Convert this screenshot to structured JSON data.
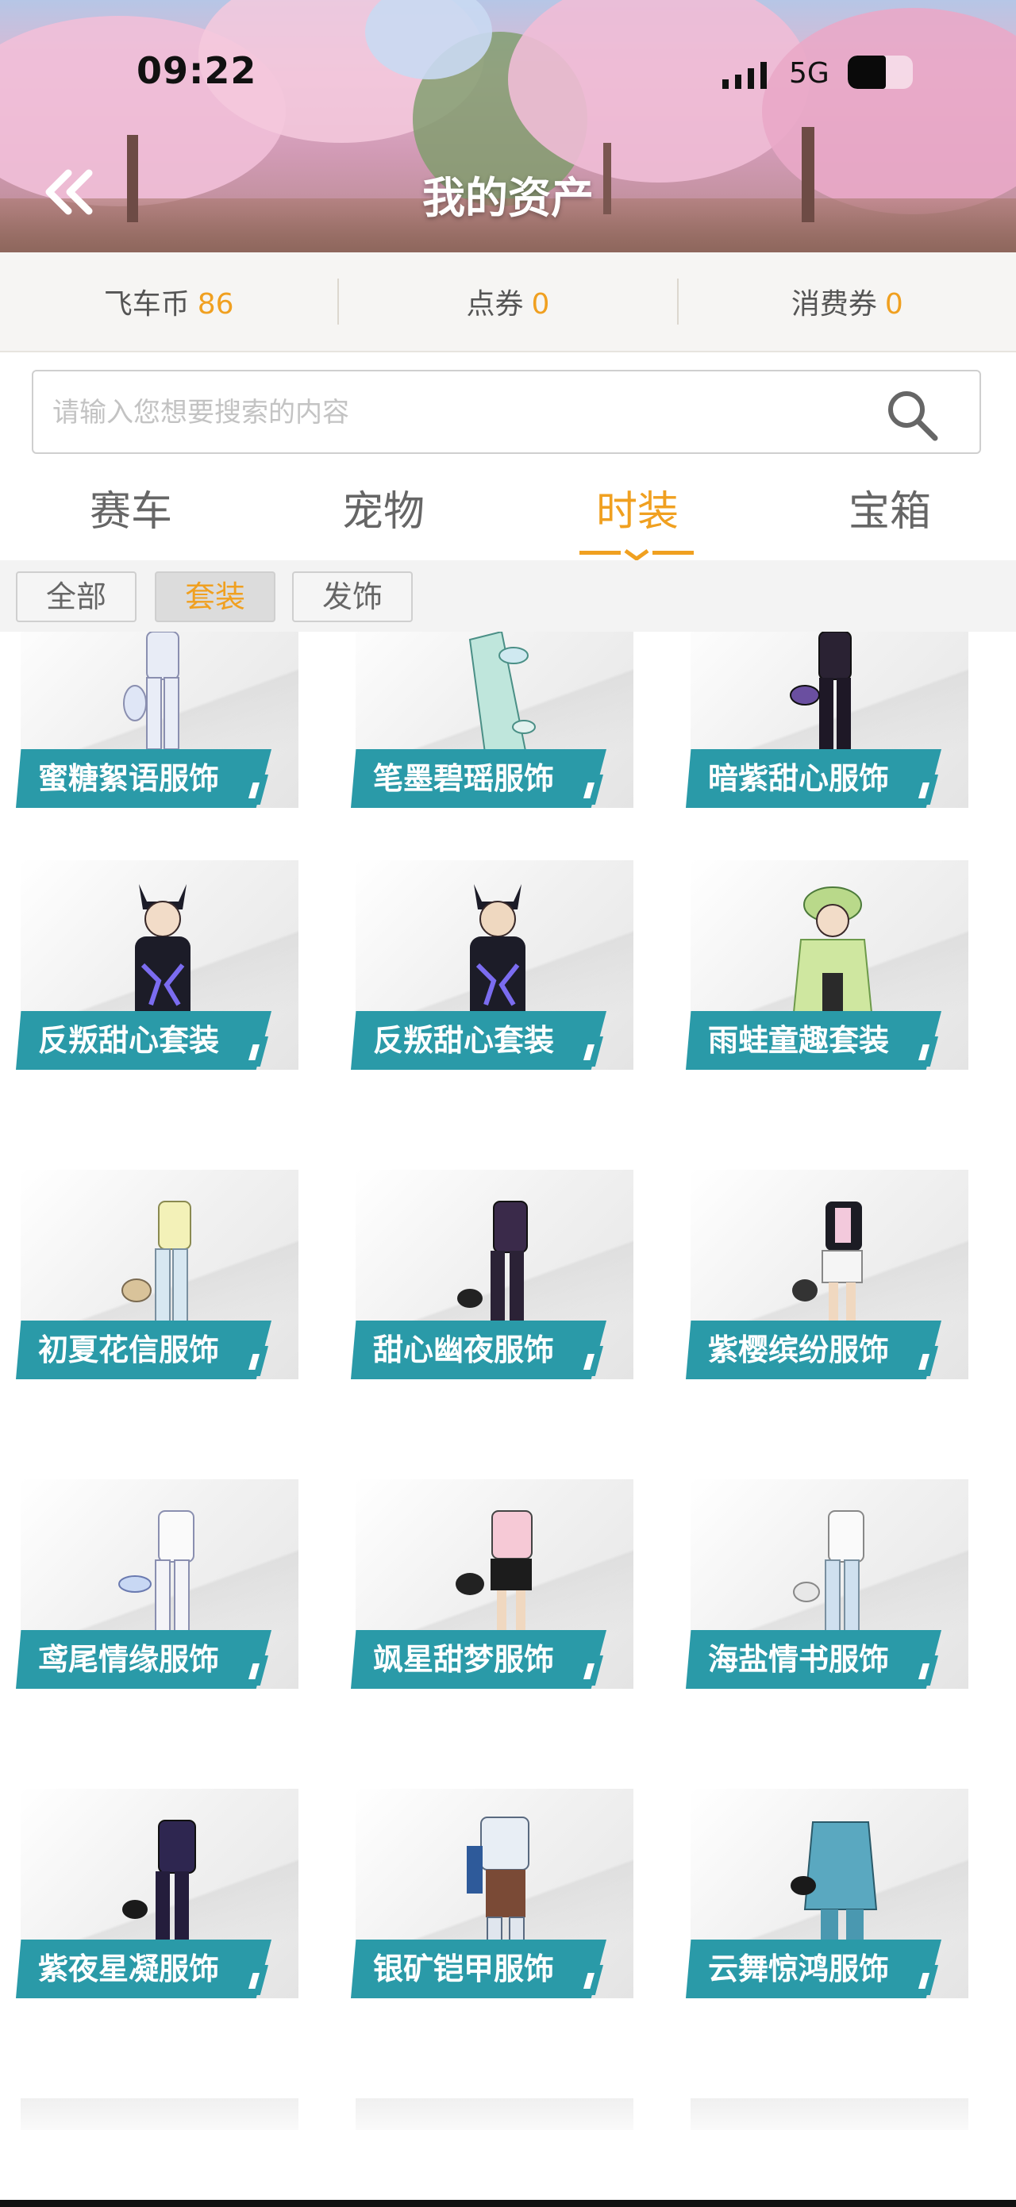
{
  "status_bar": {
    "time": "09:22",
    "network": "5G"
  },
  "header": {
    "title": "我的资产",
    "back_icon": "double-chevron-left-icon"
  },
  "currency": [
    {
      "label": "飞车币",
      "value": "86"
    },
    {
      "label": "点券",
      "value": "0"
    },
    {
      "label": "消费券",
      "value": "0"
    }
  ],
  "search": {
    "placeholder": "请输入您想要搜索的内容",
    "icon": "search-icon"
  },
  "tabs": [
    "赛车",
    "宠物",
    "时装",
    "宝箱"
  ],
  "active_tab": "时装",
  "filters": [
    "全部",
    "套装",
    "发饰"
  ],
  "active_filter": "套装",
  "items": [
    "蜜糖絮语服饰",
    "笔墨碧瑶服饰",
    "暗紫甜心服饰",
    "反叛甜心套装",
    "反叛甜心套装",
    "雨蛙童趣套装",
    "初夏花信服饰",
    "甜心幽夜服饰",
    "紫樱缤纷服饰",
    "鸢尾情缘服饰",
    "飒星甜梦服饰",
    "海盐情书服饰",
    "紫夜星凝服饰",
    "银矿铠甲服饰",
    "云舞惊鸿服饰"
  ],
  "colors": {
    "accent": "#f0a020",
    "banner": "#2a9aa8"
  }
}
